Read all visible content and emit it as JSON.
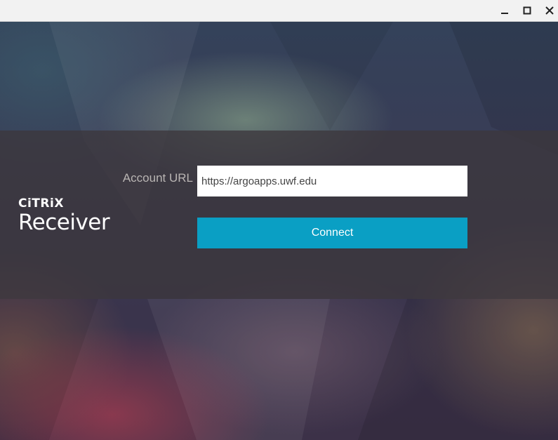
{
  "window": {
    "controls": {
      "minimize_icon": "minimize-icon",
      "maximize_icon": "maximize-icon",
      "close_icon": "close-icon"
    }
  },
  "logo": {
    "brand": "CiTRiX",
    "product": "Receiver"
  },
  "form": {
    "account_url_label": "Account URL",
    "account_url_value": "https://argoapps.uwf.edu",
    "connect_label": "Connect"
  },
  "colors": {
    "accent": "#0a9fc4",
    "band": "#3c373c",
    "titlebar": "#f2f2f2"
  }
}
